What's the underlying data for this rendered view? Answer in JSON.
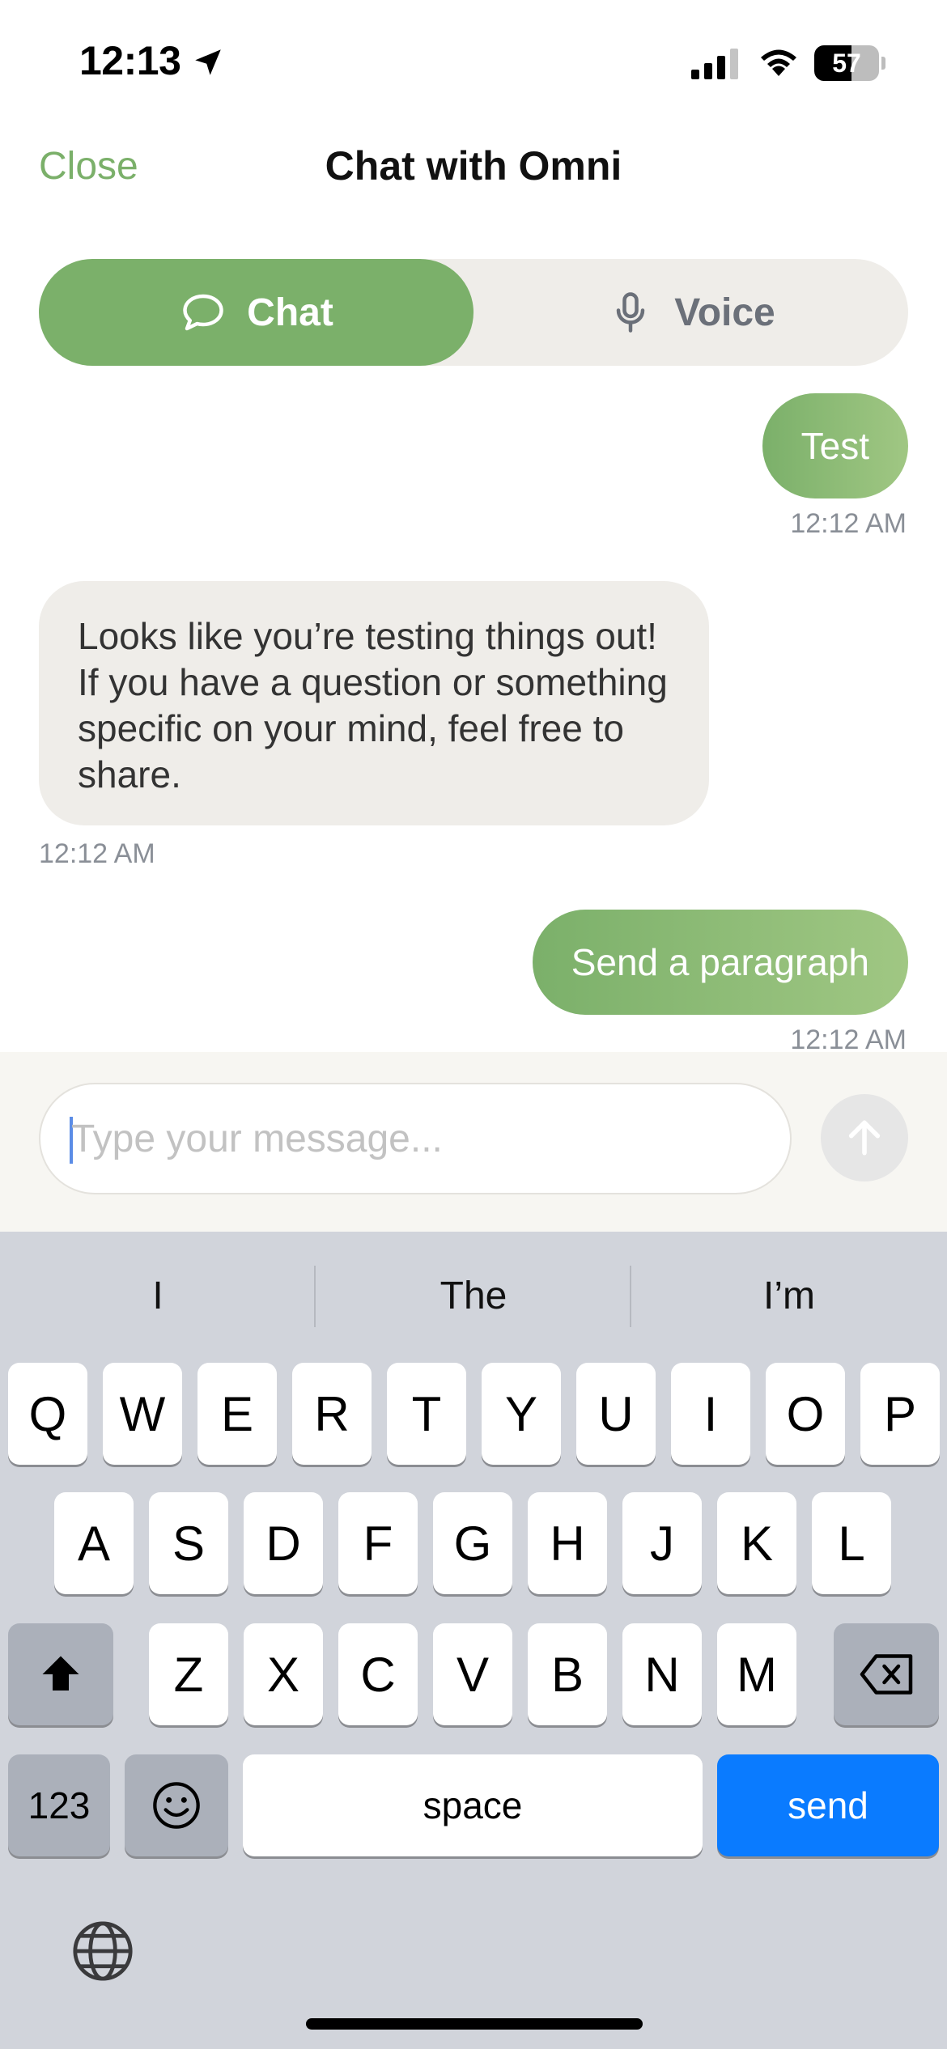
{
  "status_bar": {
    "time": "12:13",
    "battery": "57",
    "battery_level": 0.57
  },
  "nav": {
    "close_label": "Close",
    "title": "Chat with Omni"
  },
  "segment": {
    "chat_label": "Chat",
    "voice_label": "Voice",
    "active": "Chat"
  },
  "messages": [
    {
      "role": "user",
      "text": "Test",
      "time": "12:12 AM"
    },
    {
      "role": "assistant",
      "text": "Looks like you’re testing things out! If you have a question or something specific on your mind, feel free to share.",
      "time": "12:12 AM"
    },
    {
      "role": "user",
      "text": "Send a paragraph",
      "time": "12:12 AM"
    }
  ],
  "input": {
    "placeholder": "Type your message...",
    "value": ""
  },
  "keyboard": {
    "suggestions": [
      "I",
      "The",
      "I’m"
    ],
    "row1": [
      "Q",
      "W",
      "E",
      "R",
      "T",
      "Y",
      "U",
      "I",
      "O",
      "P"
    ],
    "row2": [
      "A",
      "S",
      "D",
      "F",
      "G",
      "H",
      "J",
      "K",
      "L"
    ],
    "row3": [
      "Z",
      "X",
      "C",
      "V",
      "B",
      "N",
      "M"
    ],
    "numbers_label": "123",
    "space_label": "space",
    "send_label": "send"
  },
  "colors": {
    "accent": "#7bb06a",
    "keyboard_bg": "#d1d4db",
    "send_key": "#0a7bff"
  }
}
